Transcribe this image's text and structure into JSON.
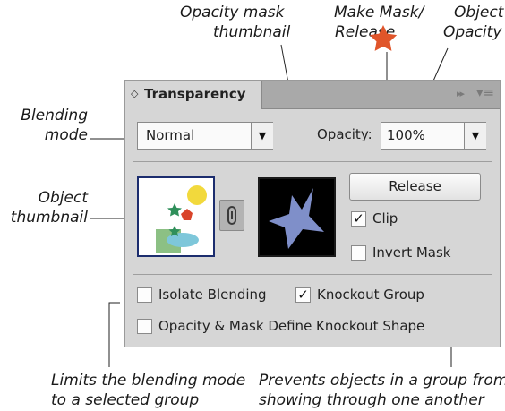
{
  "annotations": {
    "opacity_mask_thumbnail": [
      "Opacity mask",
      "thumbnail"
    ],
    "make_mask_release": [
      "Make Mask/",
      "Release"
    ],
    "object_opacity": [
      "Object",
      "Opacity"
    ],
    "blending_mode": [
      "Blending",
      "mode"
    ],
    "object_thumbnail": [
      "Object",
      "thumbnail"
    ],
    "isolate_note": [
      "Limits the blending mode",
      "to a selected group"
    ],
    "knockout_note": [
      "Prevents objects in a group from",
      "showing through one another"
    ]
  },
  "panel": {
    "tab_arrows": "◇",
    "title": "Transparency",
    "collapse_icon": "▸▸",
    "menu_icon": "▾≡",
    "blend_mode": "Normal",
    "dropdown_arrow": "▼",
    "opacity_label": "Opacity:",
    "opacity_value": "100%",
    "release_label": "Release",
    "clip_label": "Clip",
    "clip_checked": true,
    "invert_mask_label": "Invert Mask",
    "invert_mask_checked": false,
    "isolate_blending_label": "Isolate Blending",
    "isolate_blending_checked": false,
    "knockout_group_label": "Knockout Group",
    "knockout_group_checked": true,
    "opacity_mask_define_label": "Opacity & Mask Define Knockout Shape",
    "opacity_mask_define_checked": false,
    "check_glyph": "✓"
  },
  "colors": {
    "mask_star": "#7f8fc9",
    "callout_star": "#e0552a",
    "panel_bg": "#d6d6d6",
    "thumb_border": "#1c2d6e"
  }
}
